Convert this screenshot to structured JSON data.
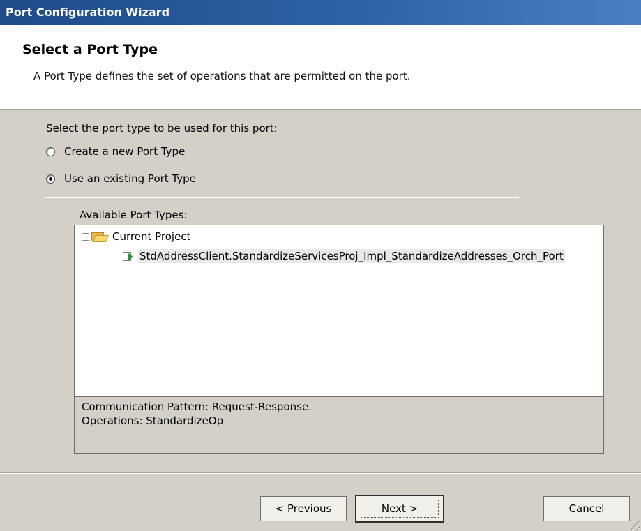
{
  "window": {
    "title": "Port Configuration Wizard"
  },
  "header": {
    "title": "Select a Port Type",
    "description": "A Port Type defines the set of operations that are permitted on the port."
  },
  "selection": {
    "prompt": "Select the port type to be used for this port:",
    "options": [
      {
        "label": "Create a new Port Type",
        "checked": false
      },
      {
        "label": "Use an existing Port Type",
        "checked": true
      }
    ]
  },
  "available": {
    "label": "Available Port Types:",
    "tree": {
      "root": {
        "label": "Current Project",
        "expander": "−",
        "icon": "folder-open-icon"
      },
      "child": {
        "label": "StdAddressClient.StandardizeServicesProj_Impl_StandardizeAddresses_Orch_Port",
        "icon": "port-type-icon"
      }
    }
  },
  "info": {
    "pattern": "Communication Pattern: Request-Response.",
    "operations": "Operations: StandardizeOp"
  },
  "buttons": {
    "previous": "< Previous",
    "next": "Next >",
    "cancel": "Cancel"
  }
}
